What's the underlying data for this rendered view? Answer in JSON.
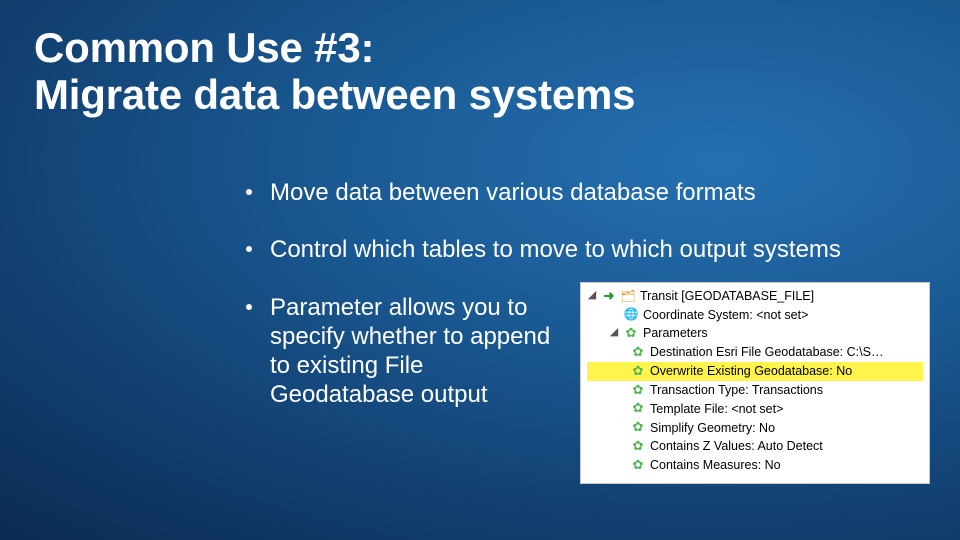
{
  "title_line1": "Common Use #3:",
  "title_line2": "Migrate data between systems",
  "bullets": [
    "Move data between various database formats",
    "Control which tables to move to which output systems",
    "Parameter allows you to specify whether to append to existing File Geodatabase output"
  ],
  "panel": {
    "root": "Transit [GEODATABASE_FILE]",
    "coord": "Coordinate System: <not set>",
    "params_label": "Parameters",
    "params": [
      {
        "text": "Destination Esri File Geodatabase: C:\\S…",
        "highlight": false
      },
      {
        "text": "Overwrite Existing Geodatabase: No",
        "highlight": true
      },
      {
        "text": "Transaction Type: Transactions",
        "highlight": false
      },
      {
        "text": "Template File: <not set>",
        "highlight": false
      },
      {
        "text": "Simplify Geometry: No",
        "highlight": false
      },
      {
        "text": "Contains Z Values: Auto Detect",
        "highlight": false
      },
      {
        "text": "Contains Measures: No",
        "highlight": false
      }
    ]
  },
  "glyphs": {
    "twist_open": "◢",
    "arrow": "➜",
    "db": "🗂",
    "globe": "🌐",
    "gear": "✿"
  }
}
